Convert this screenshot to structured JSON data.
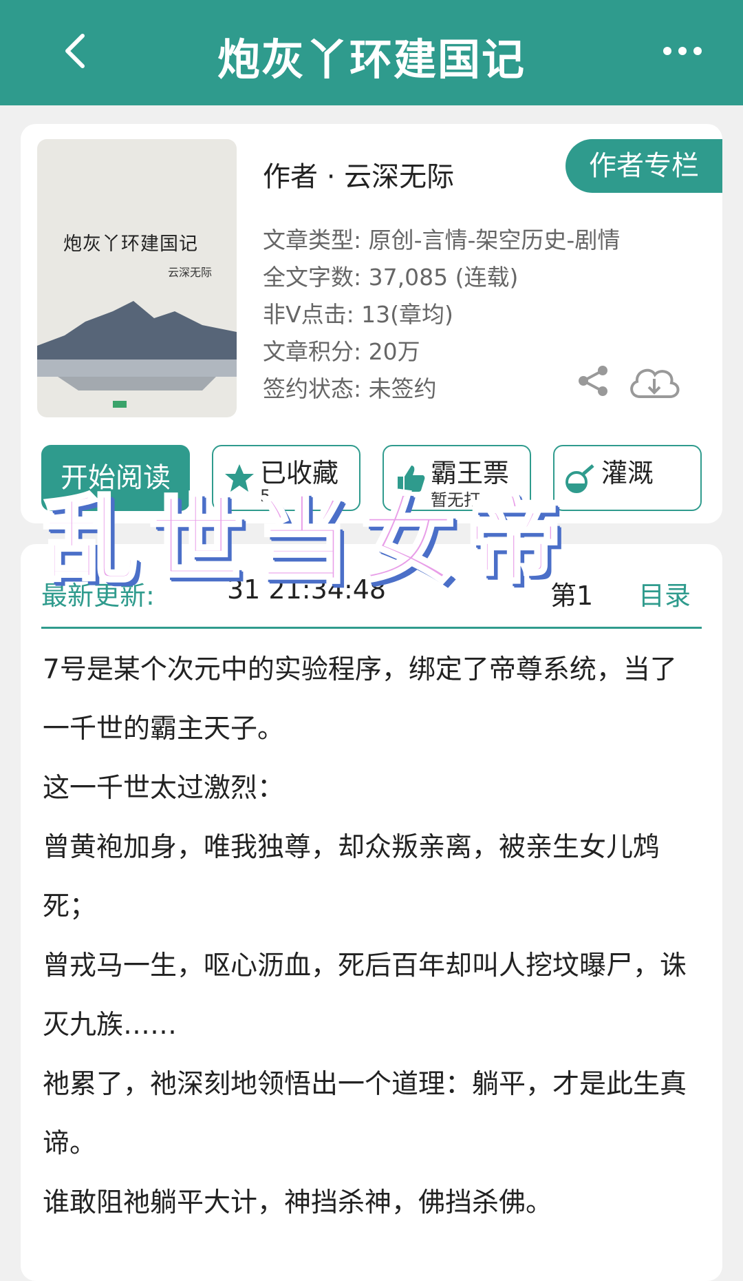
{
  "header": {
    "title": "炮灰丫环建国记"
  },
  "cover": {
    "title": "炮灰丫环建国记",
    "author": "云深无际"
  },
  "book": {
    "author_line": "作者 · 云深无际",
    "author_column": "作者专栏",
    "meta": [
      "文章类型: 原创-言情-架空历史-剧情",
      "全文字数: 37,085 (连载)",
      "非V点击: 13(章均)",
      "文章积分: 20万",
      "签约状态:  未签约"
    ]
  },
  "actions": {
    "read": "开始阅读",
    "collect": {
      "label": "已收藏",
      "sub": "5"
    },
    "vote": {
      "label": "霸王票",
      "sub": "暂无打"
    },
    "water": {
      "label": "灌溉",
      "sub": ""
    }
  },
  "update": {
    "label": "最新更新:",
    "time": "31 21:34:48",
    "chapter": "第1",
    "toc": "目录"
  },
  "intro": [
    "7号是某个次元中的实验程序，绑定了帝尊系统，当了一千世的霸主天子。",
    "这一千世太过激烈：",
    "曾黄袍加身，唯我独尊，却众叛亲离，被亲生女儿鸩死；",
    "曾戎马一生，呕心沥血，死后百年却叫人挖坟曝尸，诛灭九族……",
    "祂累了，祂深刻地领悟出一个道理：躺平，才是此生真谛。",
    "谁敢阻祂躺平大计，神挡杀神，佛挡杀佛。"
  ],
  "overlay_text": "乱世当女帝",
  "colors": {
    "accent": "#2f9b8d",
    "overlay": "#e89ee8"
  }
}
